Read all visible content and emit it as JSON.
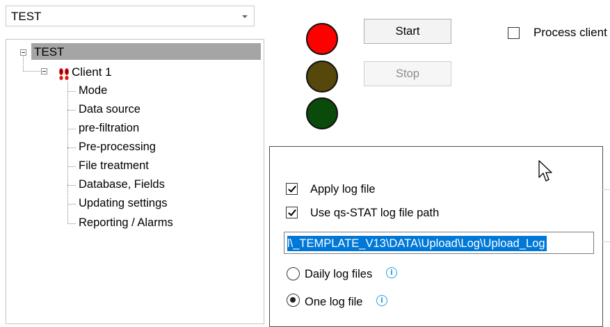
{
  "profile_combo": {
    "value": "TEST"
  },
  "tree": {
    "root_label": "TEST",
    "client_label": "Client 1",
    "children": [
      "Mode",
      "Data source",
      "pre-filtration",
      "Pre-processing",
      "File treatment",
      "Database, Fields",
      "Updating settings",
      "Reporting / Alarms"
    ]
  },
  "controls": {
    "start_label": "Start",
    "stop_label": "Stop",
    "process_label": "Process client"
  },
  "status_lights": {
    "red": "#ff0000",
    "yellow": "#55480a",
    "green": "#0a4a0a"
  },
  "log_popup": {
    "apply_log_label": "Apply log file",
    "apply_log_checked": true,
    "use_path_label": "Use qs-STAT log file path",
    "use_path_checked": true,
    "path_value": "l\\_TEMPLATE_V13\\DATA\\Upload\\Log\\Upload_Log",
    "daily_label": "Daily log files",
    "daily_selected": false,
    "one_label": "One log file",
    "one_selected": true,
    "info_glyph": "i"
  }
}
